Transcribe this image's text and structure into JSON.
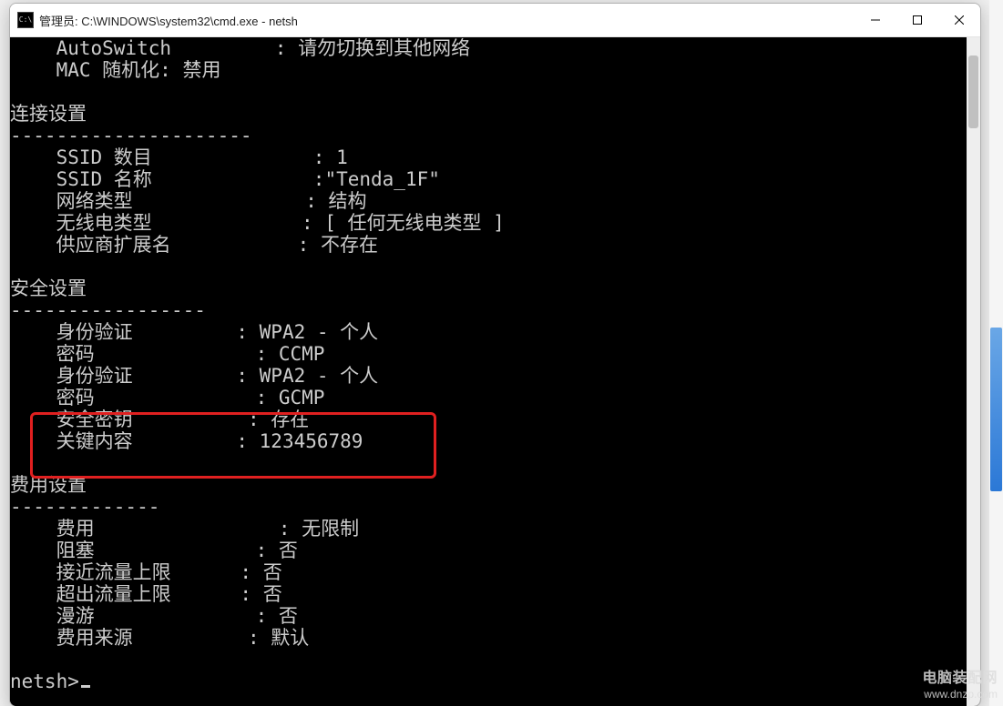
{
  "window": {
    "title": "管理员: C:\\WINDOWS\\system32\\cmd.exe - netsh"
  },
  "top_kv": {
    "autoswitch_key": "AutoSwitch",
    "autoswitch_val": "请勿切换到其他网络",
    "macrand_key": "MAC 随机化",
    "macrand_val": "禁用"
  },
  "sections": {
    "conn_title": "连接设置",
    "conn_divider": "---------------------",
    "conn_items": {
      "ssid_count_k": "SSID 数目",
      "ssid_count_v": "1",
      "ssid_name_k": "SSID 名称",
      "ssid_name_v": "\"Tenda_1F\"",
      "net_type_k": "网络类型",
      "net_type_v": "结构",
      "radio_k": "无线电类型",
      "radio_v": "[ 任何无线电类型 ]",
      "vendor_k": "供应商扩展名",
      "vendor_v": "不存在"
    },
    "sec_title": "安全设置",
    "sec_divider": "-----------------",
    "sec_items": {
      "auth1_k": "身份验证",
      "auth1_v": "WPA2 - 个人",
      "cipher1_k": "密码",
      "cipher1_v": "CCMP",
      "auth2_k": "身份验证",
      "auth2_v": "WPA2 - 个人",
      "cipher2_k": "密码",
      "cipher2_v": "GCMP",
      "seckey_k": "安全密钥",
      "seckey_v": "存在",
      "keycont_k": "关键内容",
      "keycont_v": "123456789"
    },
    "cost_title": "费用设置",
    "cost_divider": "-------------",
    "cost_items": {
      "cost_k": "费用",
      "cost_v": "无限制",
      "block_k": "阻塞",
      "block_v": "否",
      "near_k": "接近流量上限",
      "near_v": "否",
      "over_k": "超出流量上限",
      "over_v": "否",
      "roam_k": "漫游",
      "roam_v": "否",
      "src_k": "费用来源",
      "src_v": "默认"
    }
  },
  "prompt": "netsh>",
  "watermark": {
    "line1": "电脑装配网",
    "line2": "www.dnzp.com"
  }
}
